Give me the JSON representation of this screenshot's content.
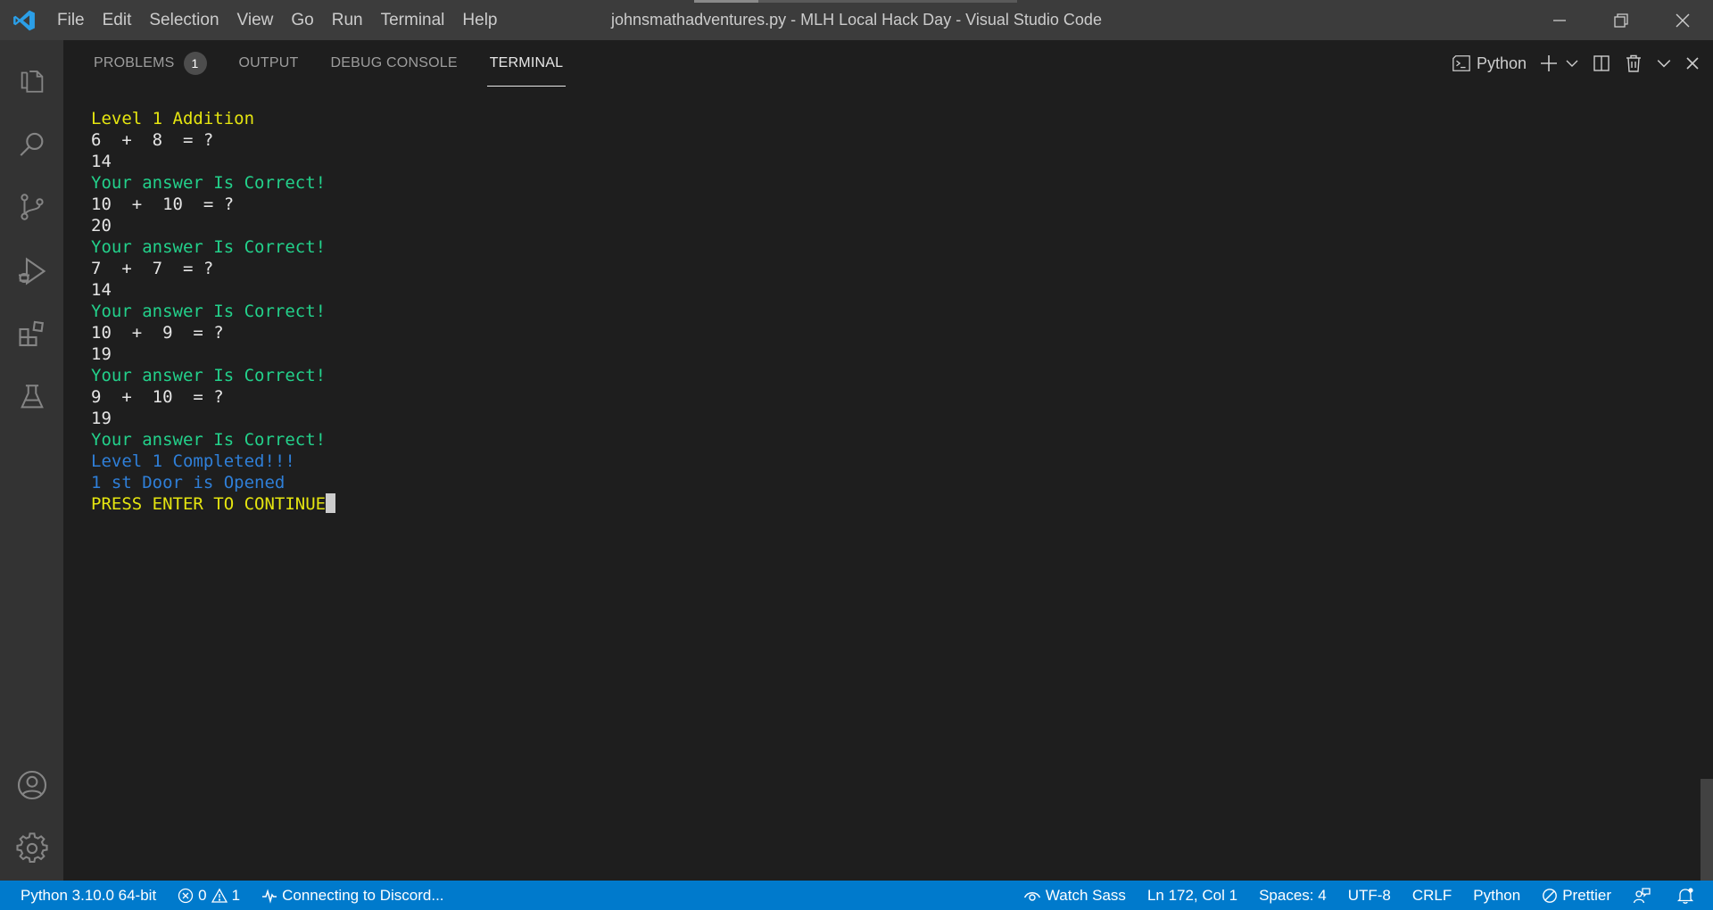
{
  "window": {
    "title": "johnsmathadventures.py - MLH Local Hack Day - Visual Studio Code"
  },
  "menu": [
    "File",
    "Edit",
    "Selection",
    "View",
    "Go",
    "Run",
    "Terminal",
    "Help"
  ],
  "panel": {
    "tabs": [
      {
        "label": "PROBLEMS",
        "badge": "1",
        "active": false
      },
      {
        "label": "OUTPUT",
        "active": false
      },
      {
        "label": "DEBUG CONSOLE",
        "active": false
      },
      {
        "label": "TERMINAL",
        "active": true
      }
    ],
    "terminal_profile": "Python"
  },
  "terminal": {
    "lines": [
      {
        "text": "Level 1 Addition",
        "color": "yellow"
      },
      {
        "text": "6  +  8  = ?",
        "color": "white"
      },
      {
        "text": "14",
        "color": "white"
      },
      {
        "text": "Your answer Is Correct!",
        "color": "green"
      },
      {
        "text": "10  +  10  = ?",
        "color": "white"
      },
      {
        "text": "20",
        "color": "white"
      },
      {
        "text": "Your answer Is Correct!",
        "color": "green"
      },
      {
        "text": "7  +  7  = ?",
        "color": "white"
      },
      {
        "text": "14",
        "color": "white"
      },
      {
        "text": "Your answer Is Correct!",
        "color": "green"
      },
      {
        "text": "10  +  9  = ?",
        "color": "white"
      },
      {
        "text": "19",
        "color": "white"
      },
      {
        "text": "Your answer Is Correct!",
        "color": "green"
      },
      {
        "text": "9  +  10  = ?",
        "color": "white"
      },
      {
        "text": "19",
        "color": "white"
      },
      {
        "text": "Your answer Is Correct!",
        "color": "green"
      },
      {
        "text": "Level 1 Completed!!!",
        "color": "blue"
      },
      {
        "text": "1 st Door is Opened",
        "color": "blue"
      },
      {
        "text": "PRESS ENTER TO CONTINUE",
        "color": "yellow"
      }
    ]
  },
  "statusbar": {
    "interpreter": "Python 3.10.0 64-bit",
    "errors": "0",
    "warnings": "1",
    "discord": "Connecting to Discord...",
    "watch_sass": "Watch Sass",
    "position": "Ln 172, Col 1",
    "spaces": "Spaces: 4",
    "encoding": "UTF-8",
    "eol": "CRLF",
    "language": "Python",
    "formatter": "Prettier"
  },
  "colors": {
    "accent": "#007acc",
    "yellow": "#e5e510",
    "green": "#23d18b",
    "blue": "#2f7fd8",
    "white": "#e5e5e5"
  }
}
